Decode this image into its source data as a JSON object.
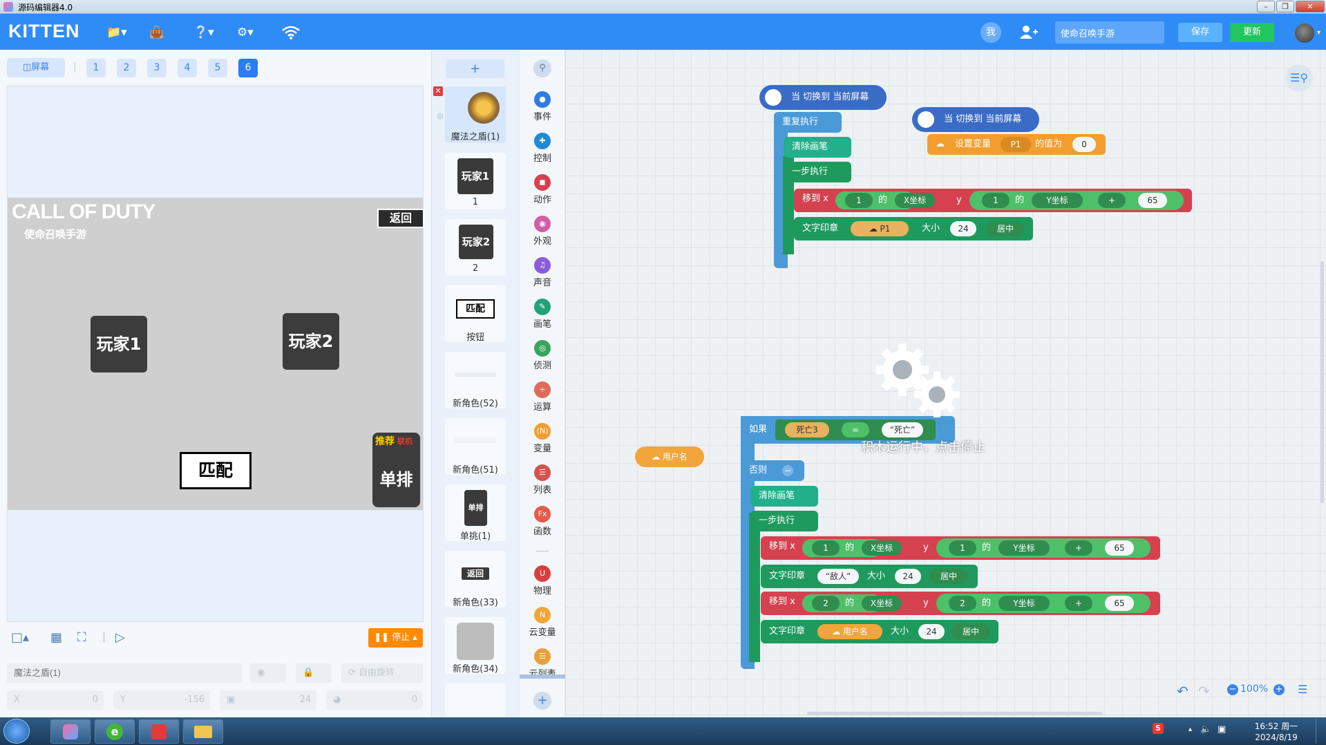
{
  "window": {
    "title": "源码编辑器4.0",
    "buttons": [
      "–",
      "❐",
      "✕"
    ]
  },
  "topbar": {
    "logo": "KITTEN",
    "me_label": "我",
    "project_name": "使命召唤手游",
    "save_label": "保存",
    "update_label": "更新"
  },
  "stage_panel": {
    "screen_button": "屏幕",
    "pages": [
      "1",
      "2",
      "3",
      "4",
      "5",
      "6"
    ],
    "active_page": "6",
    "stage": {
      "logo_line1": "CALL OF DUTY",
      "logo_line2": "使命召唤手游",
      "back_label": "返回",
      "player1": "玩家1",
      "player2": "玩家2",
      "match_label": "匹配",
      "badge_top": "推荐",
      "badge_red": "联机",
      "solo_label": "单排"
    },
    "stop_label": "停止",
    "props": {
      "name_placeholder": "魔法之盾(1)",
      "rotate_label": "自由旋转",
      "x_label": "X",
      "x_value": "0",
      "y_label": "Y",
      "y_value": "-156",
      "size_value": "24",
      "dir_value": "0"
    }
  },
  "sprites": {
    "add_label": "+",
    "items": [
      {
        "label": "魔法之盾(1)",
        "thumb": ""
      },
      {
        "label": "1",
        "thumb": "玩家1"
      },
      {
        "label": "2",
        "thumb": "玩家2"
      },
      {
        "label": "按钮",
        "thumb": "匹配"
      },
      {
        "label": "新角色(52)",
        "thumb": ""
      },
      {
        "label": "新角色(51)",
        "thumb": ""
      },
      {
        "label": "单挑(1)",
        "thumb": "单排"
      },
      {
        "label": "新角色(33)",
        "thumb": "返回"
      },
      {
        "label": "新角色(34)",
        "thumb": ""
      }
    ]
  },
  "categories": [
    {
      "label": "事件",
      "color": "#2f7be0"
    },
    {
      "label": "控制",
      "color": "#1f8ad8"
    },
    {
      "label": "动作",
      "color": "#d6414f"
    },
    {
      "label": "外观",
      "color": "#d05ea6"
    },
    {
      "label": "声音",
      "color": "#8a5cd8"
    },
    {
      "label": "画笔",
      "color": "#21a37a"
    },
    {
      "label": "侦测",
      "color": "#3aa65b"
    },
    {
      "label": "运算",
      "color": "#e06a5b"
    },
    {
      "label": "变量",
      "color": "#f29d2e"
    },
    {
      "label": "列表",
      "color": "#d6524f"
    },
    {
      "label": "函数",
      "color": "#e55a4a"
    },
    {
      "label": "物理",
      "color": "#d64040"
    },
    {
      "label": "云变量",
      "color": "#f2a53a"
    },
    {
      "label": "云列表",
      "color": "#e9a03a"
    }
  ],
  "blocks": {
    "script1": {
      "hat": "当 切换到 当前屏幕",
      "repeat": "重复执行",
      "clear": "清除画笔",
      "step": "一步执行",
      "move": {
        "label": "移到 x",
        "n1": "1",
        "of": "的",
        "xprop": "X坐标",
        "y": "y",
        "n2": "1",
        "yprop": "Y坐标",
        "op": "+",
        "num": "65"
      },
      "print": {
        "label": "文字印章",
        "var": "P1",
        "size_label": "大小",
        "size": "24",
        "align": "居中"
      }
    },
    "script2": {
      "hat": "当 切换到 当前屏幕",
      "setvar": "设置变量",
      "var": "P1",
      "to": "的值为",
      "val": "0"
    },
    "username_reporter": "用户名",
    "script3": {
      "if_label": "如果",
      "var": "死亡3",
      "eq": "=",
      "str": "“死亡”",
      "else_label": "否则",
      "clear": "清除画笔",
      "step": "一步执行",
      "move1": {
        "label": "移到 x",
        "n1": "1",
        "of": "的",
        "xprop": "X坐标",
        "y": "y",
        "n2": "1",
        "yprop": "Y坐标",
        "op": "+",
        "num": "65"
      },
      "print1": {
        "label": "文字印章",
        "str": "“敌人”",
        "size_label": "大小",
        "size": "24",
        "align": "居中"
      },
      "move2": {
        "label": "移到 x",
        "n1": "2",
        "of": "的",
        "xprop": "X坐标",
        "y": "y",
        "n2": "2",
        "yprop": "Y坐标",
        "op": "+",
        "num": "65"
      },
      "print2": {
        "label": "文字印章",
        "var": "用户名",
        "size_label": "大小",
        "size": "24",
        "align": "居中"
      }
    },
    "running_msg": "积木运行中，点击停止"
  },
  "zoom": "100%",
  "taskbar": {
    "time": "16:52 周一",
    "date": "2024/8/19"
  }
}
